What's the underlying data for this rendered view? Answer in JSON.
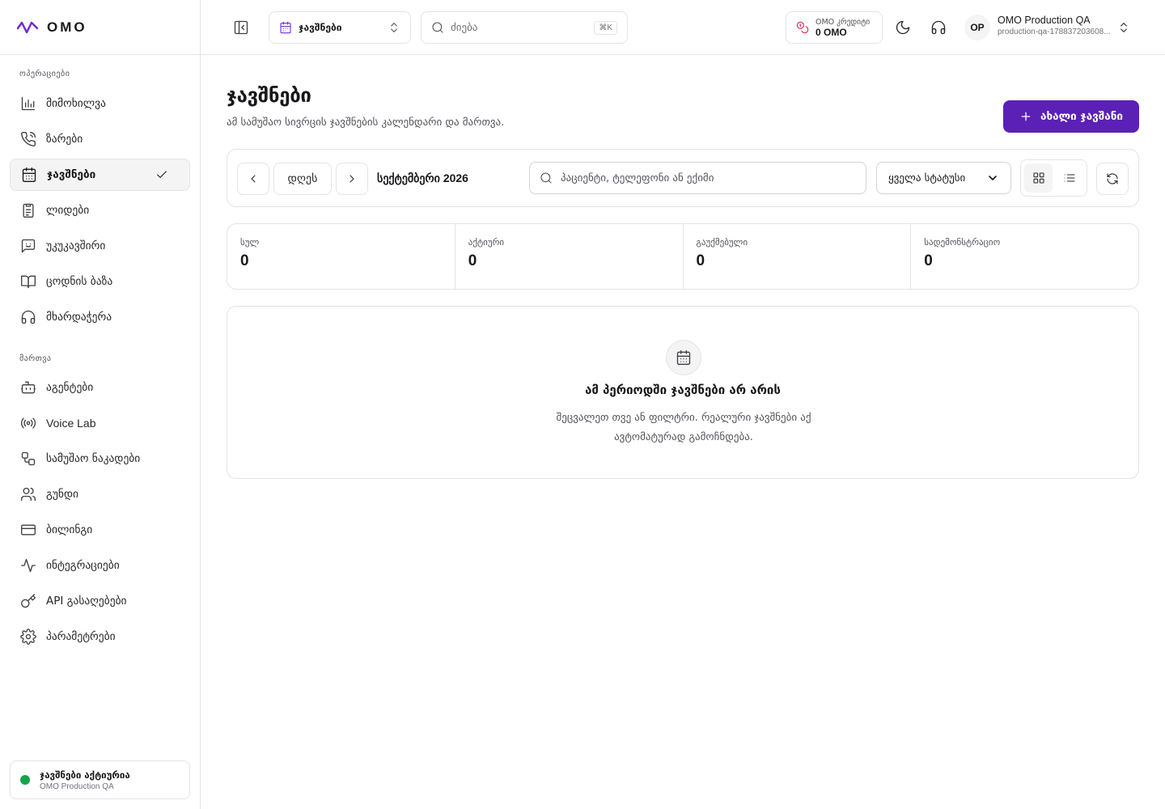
{
  "brand": {
    "name": "OMO",
    "accent": "#5b21b6",
    "logo_color": "#6d28d9"
  },
  "sidebar": {
    "sections": [
      {
        "label": "ოპერაციები"
      },
      {
        "label": "მართვა"
      }
    ],
    "items": [
      {
        "label": "მიმოხილვა",
        "icon": "bar-chart-icon"
      },
      {
        "label": "ზარები",
        "icon": "phone-icon"
      },
      {
        "label": "ჯავშნები",
        "icon": "calendar-icon",
        "active": true
      },
      {
        "label": "ლიდები",
        "icon": "clipboard-icon"
      },
      {
        "label": "უკუკავშირი",
        "icon": "message-square-icon"
      },
      {
        "label": "ცოდნის ბაზა",
        "icon": "book-icon"
      },
      {
        "label": "მხარდაჭერა",
        "icon": "headphones-icon"
      },
      {
        "label": "აგენტები",
        "icon": "bot-icon"
      },
      {
        "label": "Voice Lab",
        "icon": "radio-icon"
      },
      {
        "label": "სამუშაო ნაკადები",
        "icon": "workflow-icon"
      },
      {
        "label": "გუნდი",
        "icon": "users-icon"
      },
      {
        "label": "ბილინგი",
        "icon": "credit-card-icon"
      },
      {
        "label": "ინტეგრაციები",
        "icon": "activity-icon"
      },
      {
        "label": "API გასაღებები",
        "icon": "key-icon"
      },
      {
        "label": "პარამეტრები",
        "icon": "settings-icon"
      }
    ],
    "status": {
      "title": "ჯავშნები აქტიურია",
      "subtitle": "OMO Production QA",
      "dot_color": "#16a34a"
    }
  },
  "topbar": {
    "switcher": {
      "label": "ჯავშნები"
    },
    "search": {
      "placeholder": "ძიება",
      "shortcut": "⌘K"
    },
    "credits": {
      "label": "OMO კრედიტი",
      "value": "0 OMO",
      "icon_color": "#e11d48"
    },
    "user": {
      "initials": "OP",
      "org_name": "OMO Production QA",
      "org_id": "production-qa-178837203608..."
    }
  },
  "page": {
    "title": "ჯავშნები",
    "subtitle": "ამ სამუშაო სივრცის ჯავშნების კალენდარი და მართვა.",
    "new_button": "ახალი ჯავშანი"
  },
  "toolbar": {
    "today": "დღეს",
    "month": "სექტემბერი 2026",
    "search_placeholder": "პაციენტი, ტელეფონი ან ექიმი",
    "status_filter": "ყველა სტატუსი"
  },
  "stats": [
    {
      "label": "სულ",
      "value": "0"
    },
    {
      "label": "აქტიური",
      "value": "0"
    },
    {
      "label": "გაუქმებული",
      "value": "0"
    },
    {
      "label": "სადემონსტრაციო",
      "value": "0"
    }
  ],
  "empty_state": {
    "title": "ამ პერიოდში ჯავშნები არ არის",
    "description": "შეცვალეთ თვე ან ფილტრი. რეალური ჯავშნები აქ ავტომატურად გამოჩნდება."
  }
}
